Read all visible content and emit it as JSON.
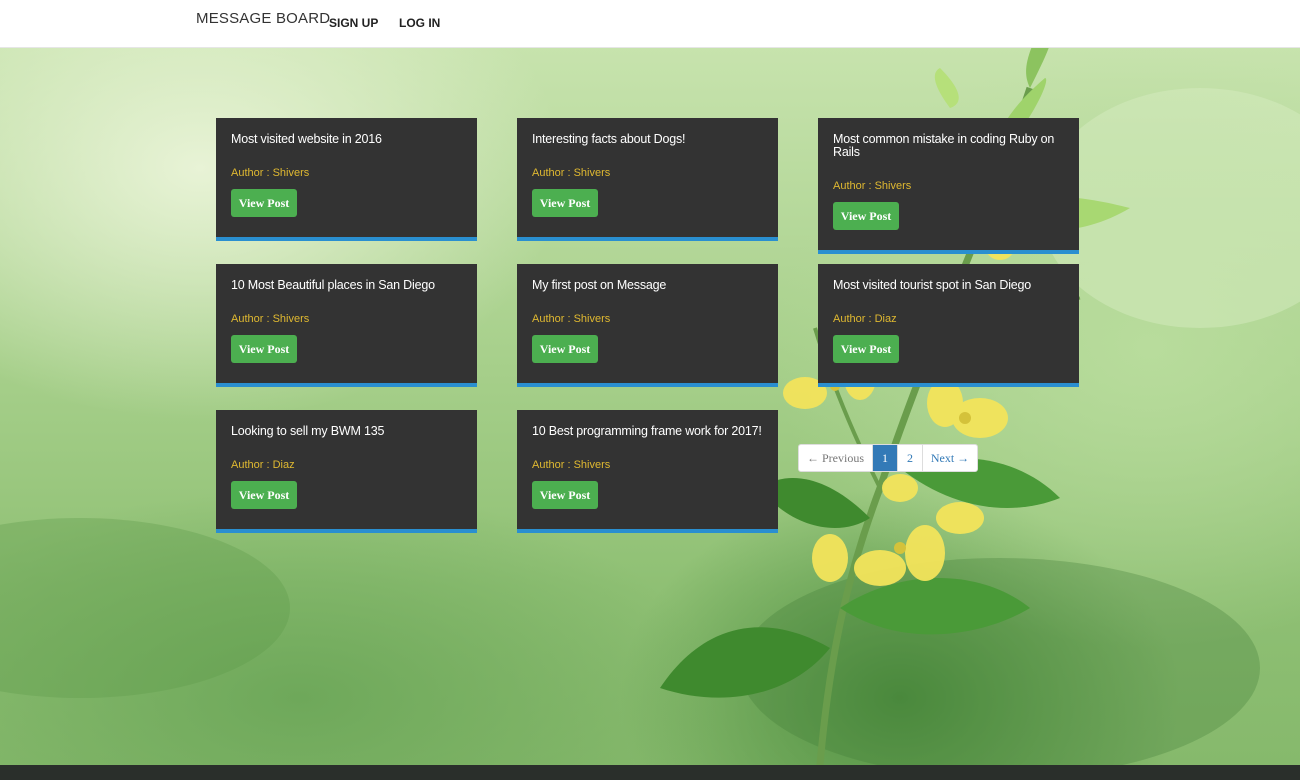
{
  "navbar": {
    "brand": "MESSAGE BOARD",
    "sign_up": "SIGN UP",
    "log_in": "LOG IN"
  },
  "posts": [
    {
      "title": "Most visited website in 2016",
      "author_label": "Author : ",
      "author": "Shivers",
      "button": "View Post"
    },
    {
      "title": "Interesting facts about Dogs!",
      "author_label": "Author : ",
      "author": "Shivers",
      "button": "View Post"
    },
    {
      "title": "Most common mistake in coding Ruby on Rails",
      "author_label": "Author : ",
      "author": "Shivers",
      "button": "View Post"
    },
    {
      "title": "10 Most Beautiful places in San Diego",
      "author_label": "Author : ",
      "author": "Shivers",
      "button": "View Post"
    },
    {
      "title": "My first post on Message",
      "author_label": "Author : ",
      "author": "Shivers",
      "button": "View Post"
    },
    {
      "title": "Most visited tourist spot in San Diego",
      "author_label": "Author : ",
      "author": "Diaz",
      "button": "View Post"
    },
    {
      "title": "Looking to sell my BWM 135",
      "author_label": "Author : ",
      "author": "Diaz",
      "button": "View Post"
    },
    {
      "title": "10 Best programming frame work for 2017!",
      "author_label": "Author : ",
      "author": "Shivers",
      "button": "View Post"
    }
  ],
  "pagination": {
    "previous": "← Previous",
    "pages": [
      "1",
      "2"
    ],
    "current": "1",
    "next": "Next →"
  },
  "colors": {
    "card_bg": "#333333",
    "card_accent": "#2a8fd0",
    "author_text": "#e0b931",
    "button_bg": "#4caf50",
    "active_page": "#337ab7"
  }
}
